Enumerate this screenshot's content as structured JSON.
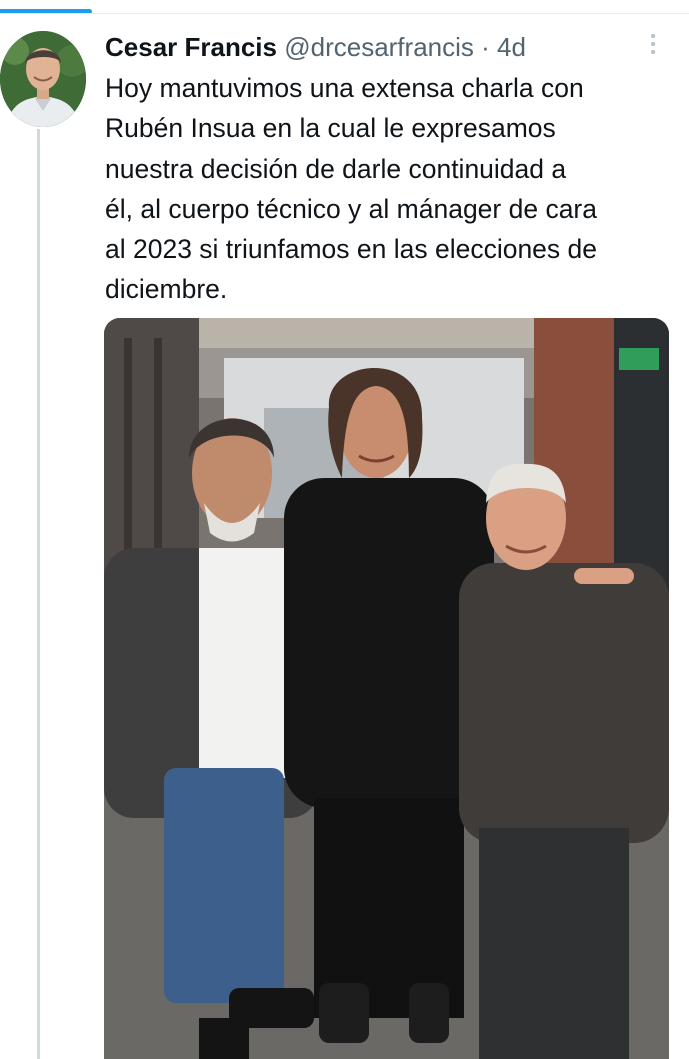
{
  "tweet": {
    "author_name": "Cesar Francis",
    "author_handle": "@drcesarfrancis",
    "separator": "·",
    "age": "4d",
    "text": "Hoy mantuvimos una extensa charla con\nRubén Insua en la cual le expresamos\nnuestra decisión de darle continuidad a\nél, al cuerpo técnico y al mánager de cara\nal 2023 si triunfamos en las elecciones de\ndiciembre."
  },
  "icons": {
    "more": "more-vertical-icon"
  },
  "colors": {
    "accent": "#1d9bf0",
    "text_primary": "#0f1419",
    "text_secondary": "#536471",
    "divider": "#cfd9de"
  }
}
